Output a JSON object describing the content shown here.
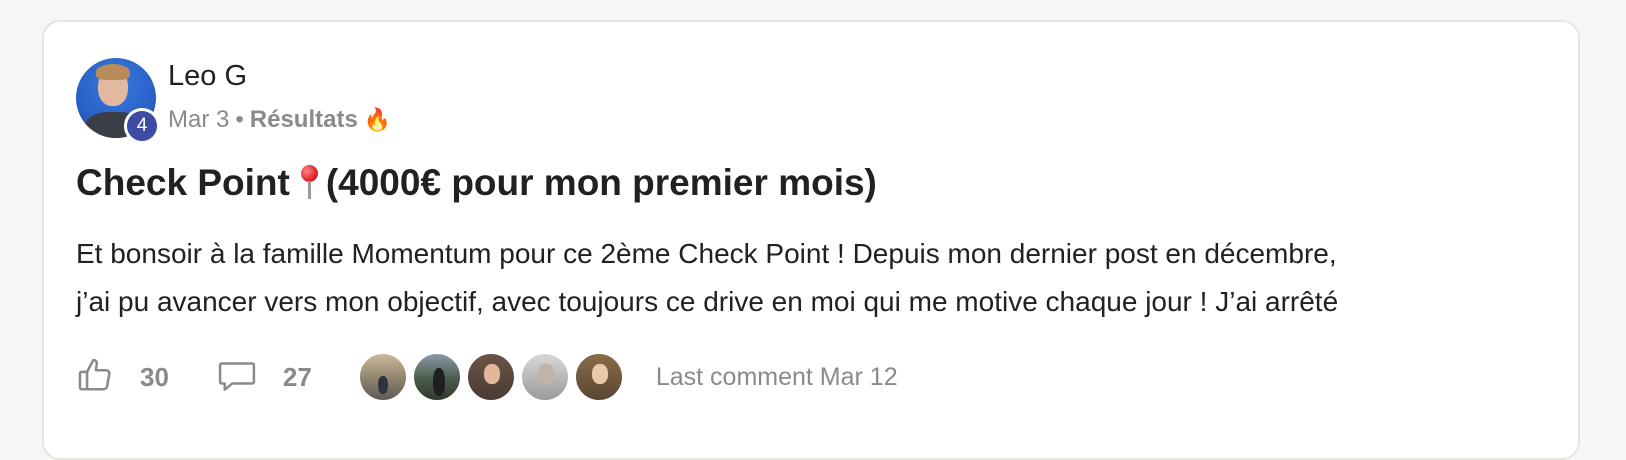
{
  "post": {
    "author": "Leo G",
    "level": "4",
    "date": "Mar 3",
    "separator": "•",
    "category": "Résultats",
    "category_emoji": "🔥",
    "title_start": "Check Point",
    "title_end": "(4000€ pour mon premier mois)",
    "body_lines": [
      "Et bonsoir à la famille Momentum pour ce 2ème Check Point ! Depuis mon dernier post en décembre,",
      "j’ai pu avancer vers mon objectif, avec toujours ce drive en moi qui me motive chaque jour ! J’ai arrêté"
    ],
    "likes": "30",
    "comments": "27",
    "last_comment": "Last comment Mar 12"
  },
  "icons": {
    "like": "thumbs-up-icon",
    "comment": "speech-bubble-icon",
    "pin": "round-pushpin-icon",
    "fire": "fire-icon"
  },
  "colors": {
    "level_badge": "#3d4ba3",
    "muted_text": "#8a8a8a",
    "primary_text": "#202124"
  }
}
